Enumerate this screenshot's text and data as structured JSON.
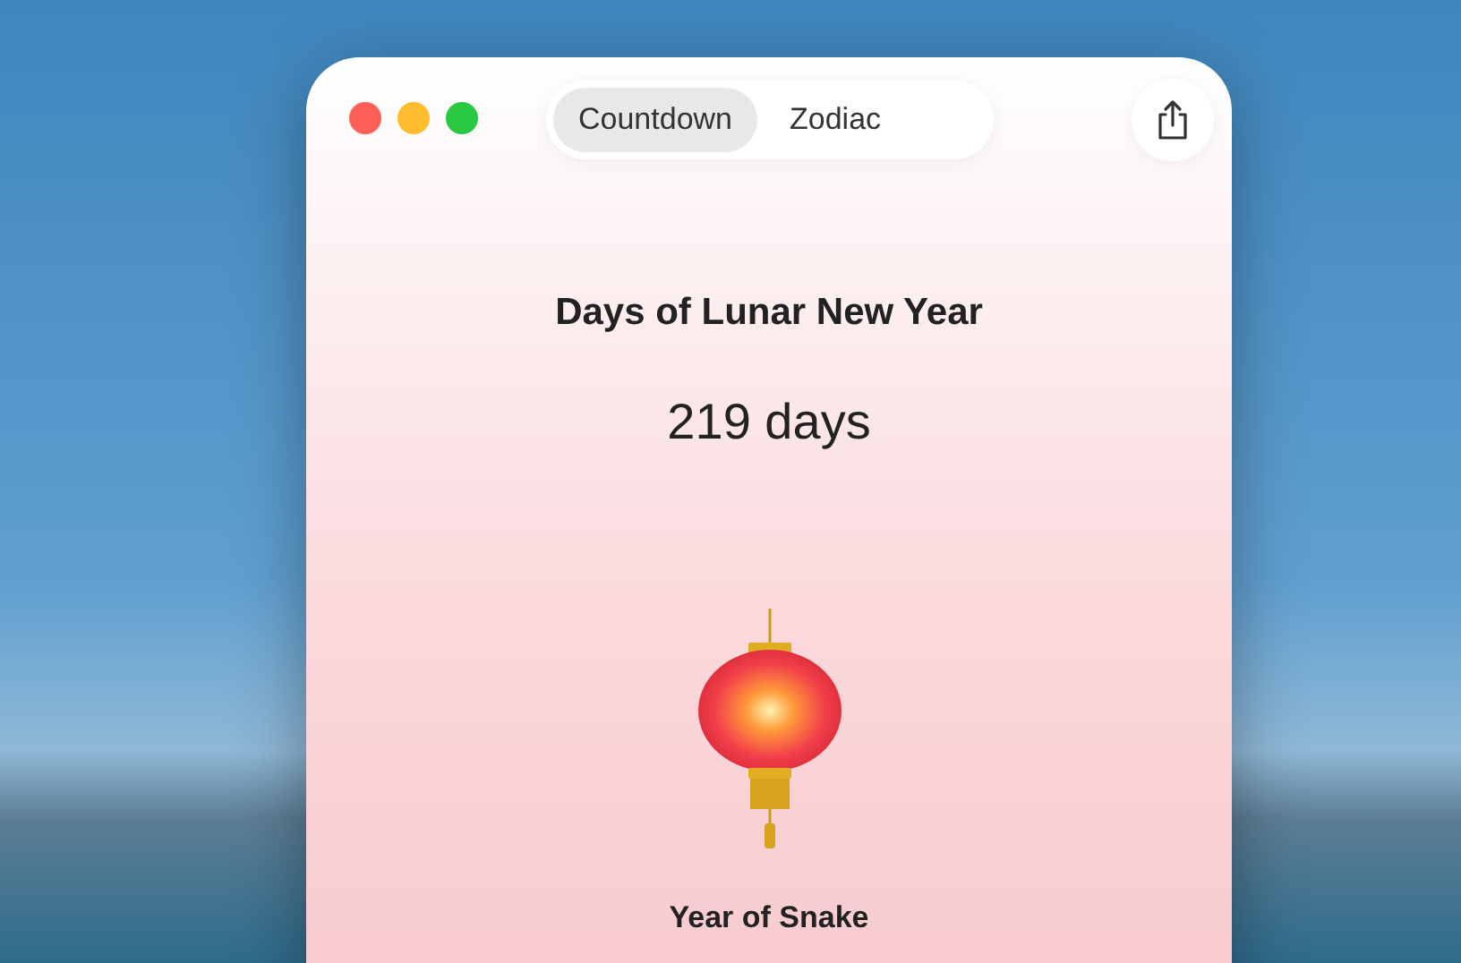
{
  "tabs": [
    {
      "label": "Countdown",
      "selected": true
    },
    {
      "label": "Zodiac",
      "selected": false
    }
  ],
  "heading": "Days of Lunar New Year",
  "countdown": "219 days",
  "zodiac_caption": "Year of Snake"
}
